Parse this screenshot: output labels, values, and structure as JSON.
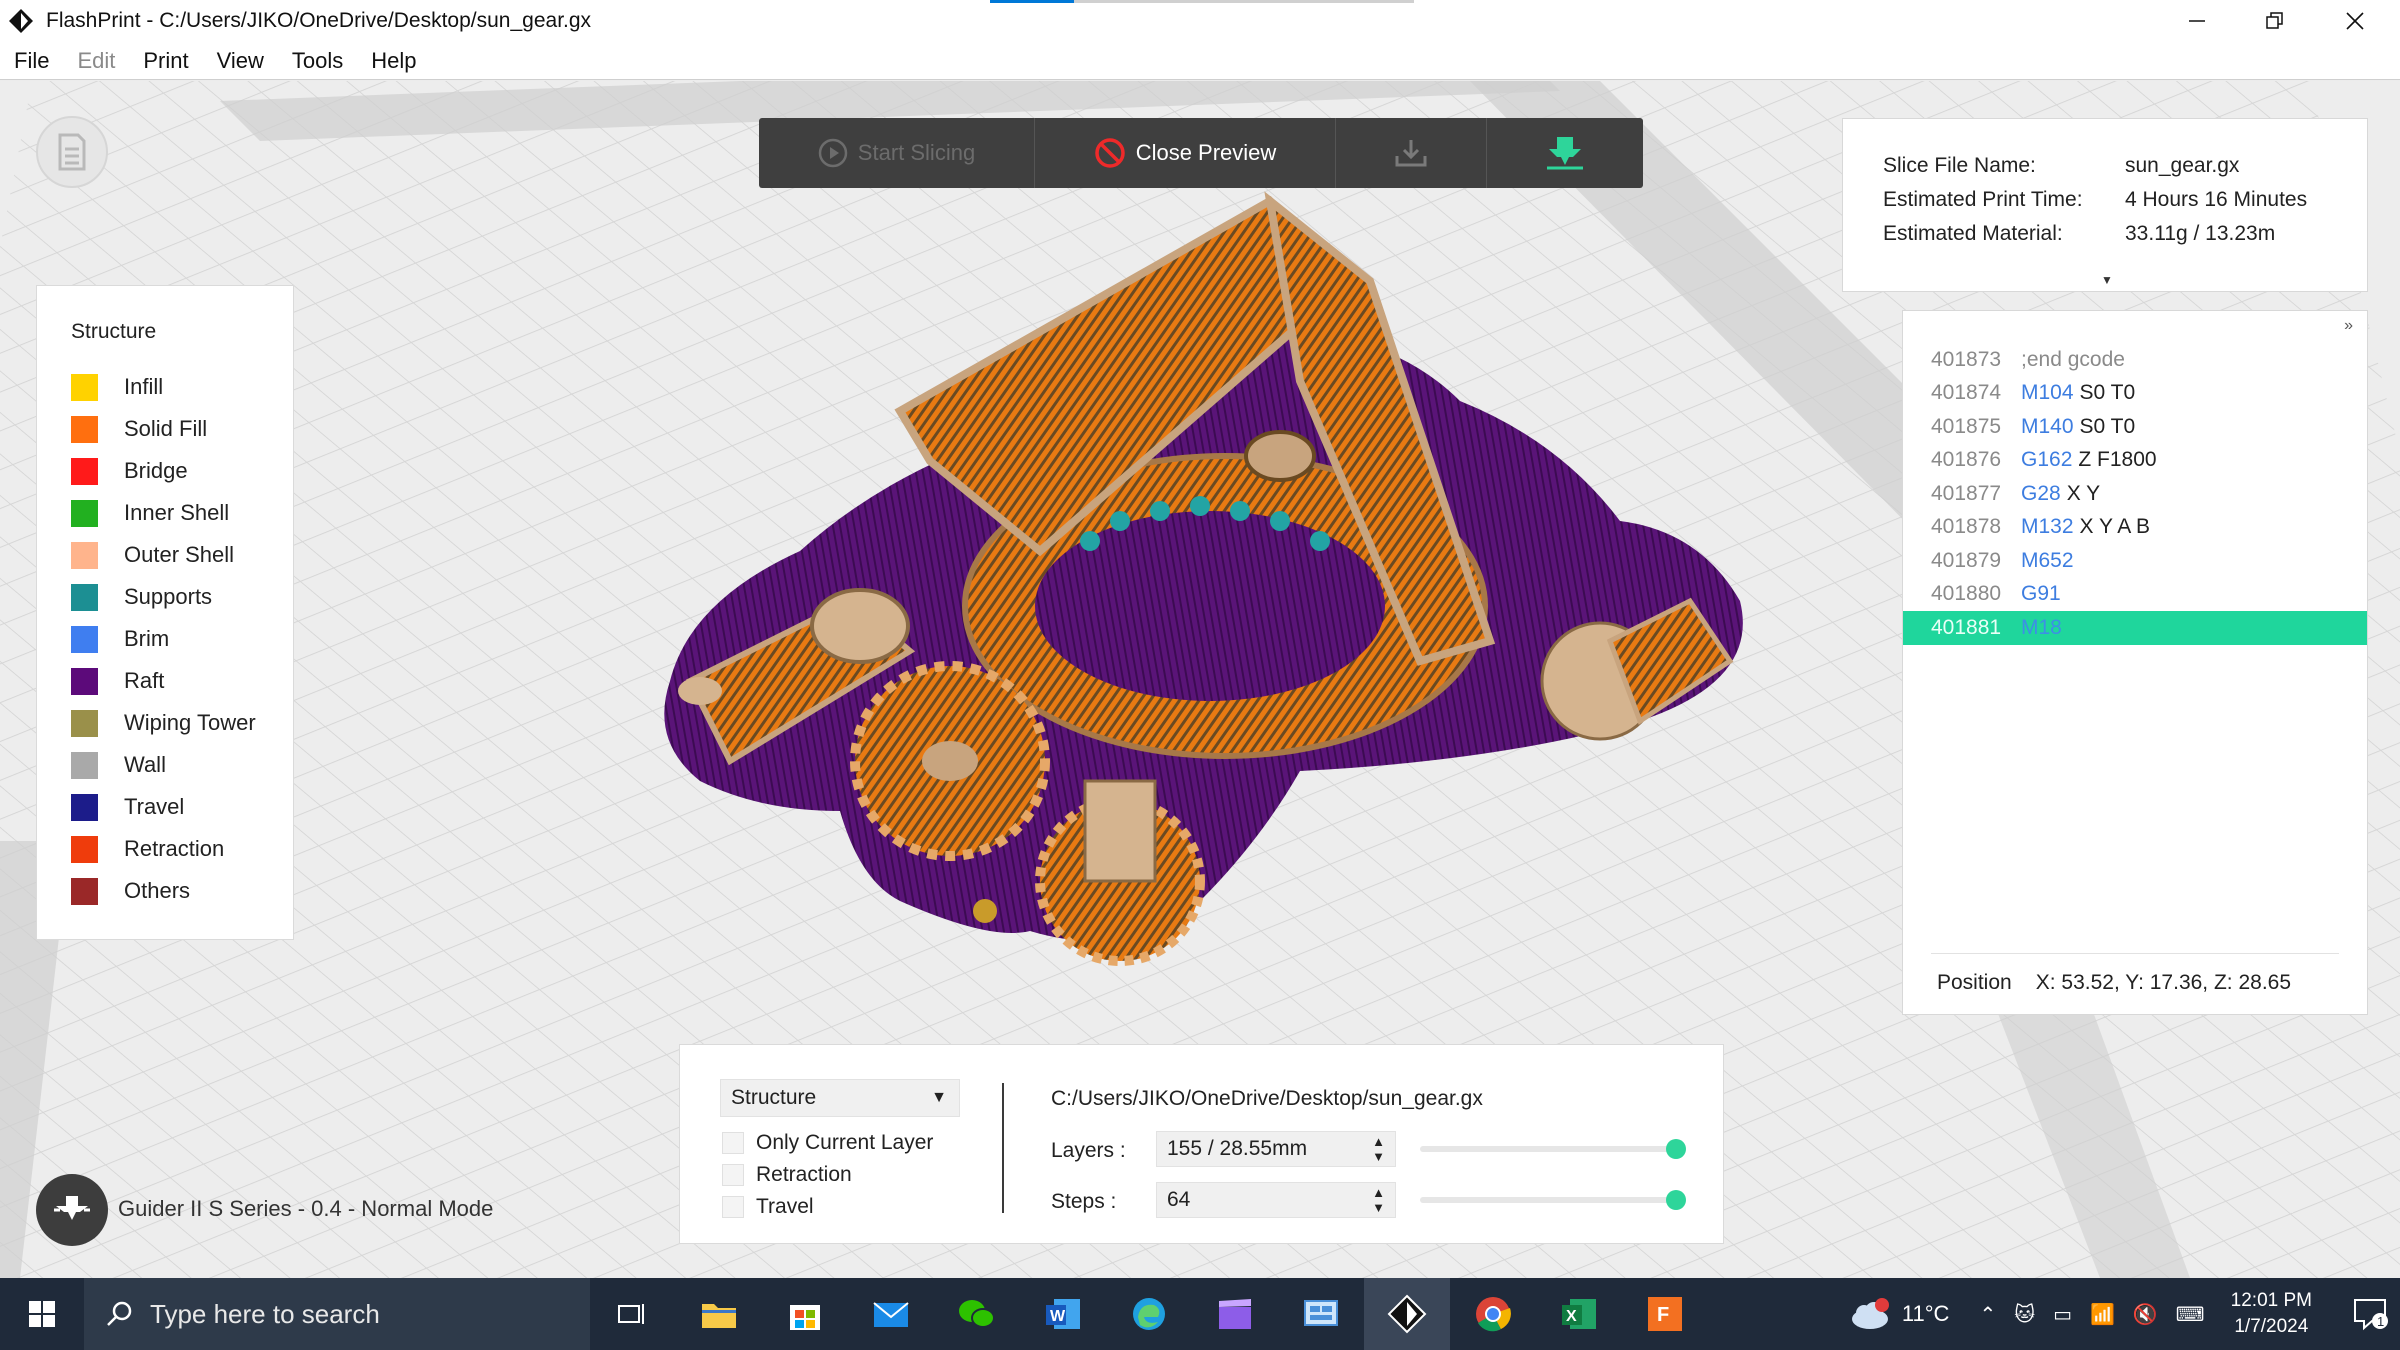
{
  "window": {
    "title": "FlashPrint - C:/Users/JIKO/OneDrive/Desktop/sun_gear.gx"
  },
  "menu": [
    "File",
    "Edit",
    "Print",
    "View",
    "Tools",
    "Help"
  ],
  "toolbar": {
    "start_slicing": "Start Slicing",
    "close_preview": "Close Preview"
  },
  "slice_info": {
    "file_name_label": "Slice File Name:",
    "file_name": "sun_gear.gx",
    "time_label": "Estimated Print Time:",
    "time": "4 Hours 16 Minutes",
    "material_label": "Estimated Material:",
    "material": "33.11g / 13.23m"
  },
  "gcode": {
    "lines": [
      {
        "num": "401873",
        "cmd": "",
        "args": ";end gcode",
        "comment": true
      },
      {
        "num": "401874",
        "cmd": "M104",
        "args": "S0 T0"
      },
      {
        "num": "401875",
        "cmd": "M140",
        "args": "S0 T0"
      },
      {
        "num": "401876",
        "cmd": "G162",
        "args": "Z F1800"
      },
      {
        "num": "401877",
        "cmd": "G28",
        "args": "X Y"
      },
      {
        "num": "401878",
        "cmd": "M132",
        "args": "X Y A B"
      },
      {
        "num": "401879",
        "cmd": "M652",
        "args": ""
      },
      {
        "num": "401880",
        "cmd": "G91",
        "args": ""
      },
      {
        "num": "401881",
        "cmd": "M18",
        "args": "",
        "active": true
      }
    ],
    "position_label": "Position",
    "position_value": "X: 53.52, Y: 17.36, Z: 28.65"
  },
  "legend": {
    "title": "Structure",
    "items": [
      {
        "label": "Infill",
        "color": "#ffd200"
      },
      {
        "label": "Solid Fill",
        "color": "#ff6f0f"
      },
      {
        "label": "Bridge",
        "color": "#ff1a1a"
      },
      {
        "label": "Inner Shell",
        "color": "#22b020"
      },
      {
        "label": "Outer Shell",
        "color": "#ffb48c"
      },
      {
        "label": "Supports",
        "color": "#1c8f93"
      },
      {
        "label": "Brim",
        "color": "#3f7ef0"
      },
      {
        "label": "Raft",
        "color": "#5c0a7a"
      },
      {
        "label": "Wiping Tower",
        "color": "#9a904a"
      },
      {
        "label": "Wall",
        "color": "#a9a9a9"
      },
      {
        "label": "Travel",
        "color": "#1c1c8a"
      },
      {
        "label": "Retraction",
        "color": "#ef3c0c"
      },
      {
        "label": "Others",
        "color": "#9a2828"
      }
    ]
  },
  "printer": {
    "label": "Guider II S Series - 0.4 - Normal Mode"
  },
  "controls": {
    "mode_select": "Structure",
    "only_current_layer": "Only Current Layer",
    "retraction": "Retraction",
    "travel": "Travel",
    "file_path": "C:/Users/JIKO/OneDrive/Desktop/sun_gear.gx",
    "layers_label": "Layers :",
    "layers_value": "155 / 28.55mm",
    "steps_label": "Steps :",
    "steps_value": "64",
    "layers_slider_level": 1.0,
    "steps_slider_level": 1.0,
    "accent_color": "#2ed59a"
  },
  "taskbar": {
    "search_placeholder": "Type here to search",
    "weather_temp": "11°C",
    "weather_badge": "1",
    "time": "12:01 PM",
    "date": "1/7/2024",
    "notification_count": "1",
    "apps": [
      "task-view",
      "file-explorer",
      "microsoft-store",
      "mail",
      "wechat",
      "word",
      "edge",
      "video-editor",
      "control-panel",
      "flashprint",
      "chrome",
      "excel",
      "fusion-360"
    ]
  }
}
